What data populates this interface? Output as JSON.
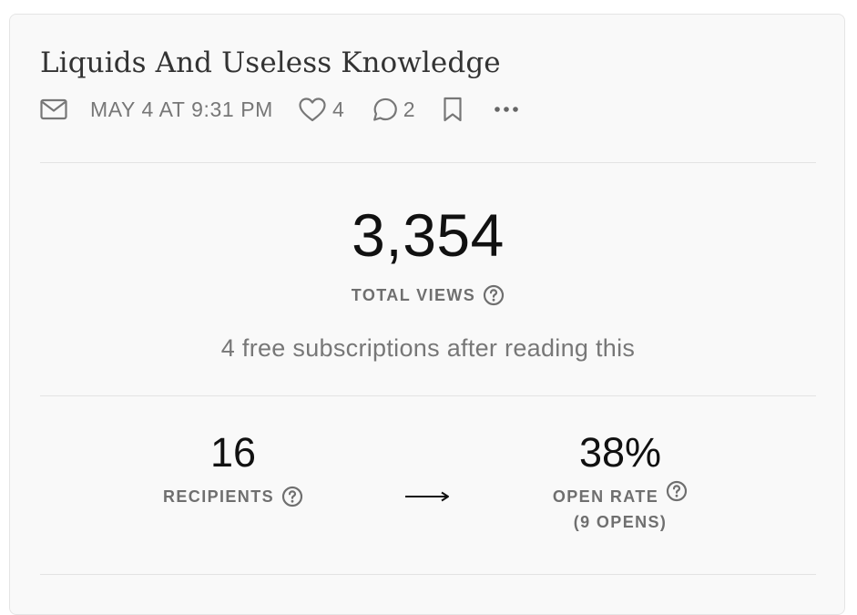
{
  "post": {
    "title": "Liquids And Useless Knowledge",
    "date": "MAY 4 AT 9:31 PM",
    "likes": "4",
    "comments": "2"
  },
  "icons": {
    "mail": "mail-icon",
    "like": "heart-icon",
    "comment": "comment-icon",
    "bookmark": "bookmark-icon",
    "more": "more-icon",
    "help": "help-circle-icon",
    "arrow": "arrow-right-icon"
  },
  "stats": {
    "total_views": "3,354",
    "total_views_label": "TOTAL VIEWS",
    "subscriptions_note": "4 free subscriptions after reading this",
    "recipients": "16",
    "recipients_label": "RECIPIENTS",
    "open_rate": "38%",
    "open_rate_label": "OPEN RATE",
    "opens": "(9 OPENS)"
  },
  "colors": {
    "card_bg": "#f9f9f9",
    "text_primary": "#111111",
    "text_muted": "#777777"
  }
}
